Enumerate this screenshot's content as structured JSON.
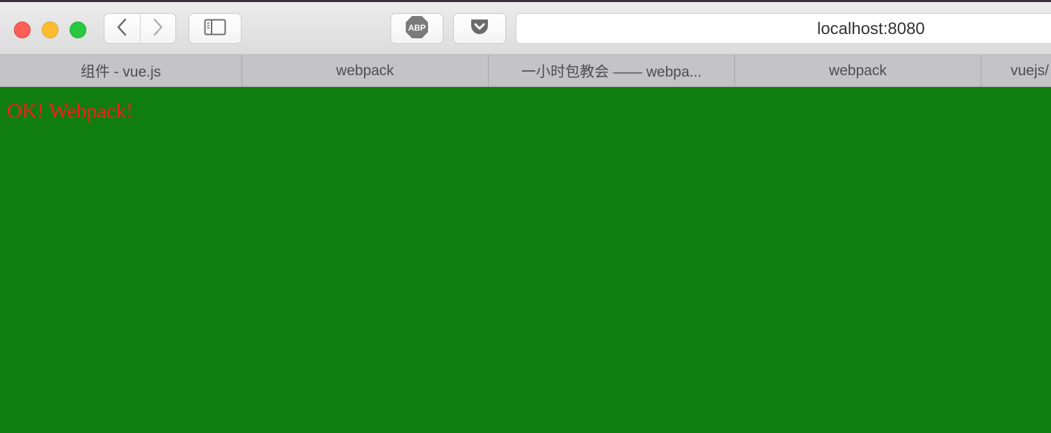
{
  "toolbar": {
    "adblock_label": "ABP",
    "address": "localhost:8080"
  },
  "tabs": [
    {
      "label": "组件 - vue.js"
    },
    {
      "label": "webpack"
    },
    {
      "label": "一小时包教会 —— webpa..."
    },
    {
      "label": "webpack"
    },
    {
      "label": "vuejs/"
    }
  ],
  "page": {
    "heading": "OK! Webpack!"
  },
  "colors": {
    "page_background": "#107d10",
    "heading_text": "#ff1a1a",
    "close": "#fe5f57",
    "minimize": "#febc2e",
    "maximize": "#28c840"
  },
  "icons": {
    "back": "chevron-left-icon",
    "forward": "chevron-right-icon",
    "sidebar": "sidebar-icon",
    "adblock": "adblock-icon",
    "pocket": "pocket-icon"
  }
}
